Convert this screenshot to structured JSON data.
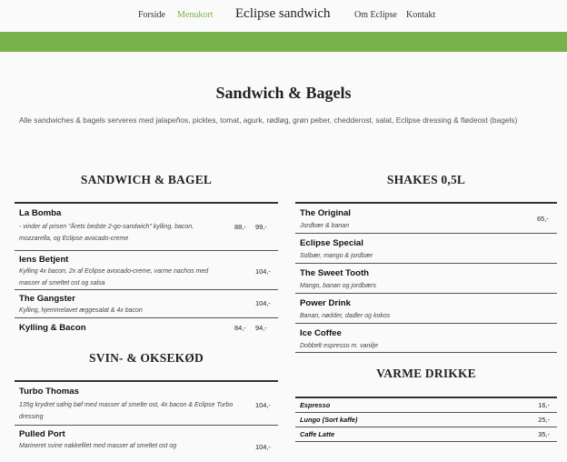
{
  "nav": {
    "items": [
      "Forside",
      "Menukort",
      "Om Eclipse",
      "Kontakt"
    ],
    "brand": "Eclipse sandwich"
  },
  "colors": {
    "accent": "#77b24a",
    "active_nav": "#7cb342"
  },
  "page_title": "Sandwich & Bagels",
  "intro": "Alle sandwiches & bagels serveres med jalapeños, pickles, tomat, agurk, rødløg, grøn peber, chedderost, salat, Eclipse dressing & flødeost (bagels)",
  "sandwich": {
    "title": "SANDWICH & BAGEL",
    "items": [
      {
        "name": "La Bomba",
        "desc": "- vinder af prisen \"Årets bedste 2-go-sandwich\" kylling, bacon, mozzarella, og Eclipse avocado-creme",
        "price1": "88,-",
        "price2": "99,-"
      },
      {
        "name": "Iens Betjent",
        "desc": "Kylling 4x bacon, 2x af Eclipse avocado-creme, varme nachos med masser af smeltet ost og salsa",
        "price1": "104,-",
        "price2": ""
      },
      {
        "name": "The Gangster",
        "desc": "Kylling, hjemmelavet æggesalat & 4x bacon",
        "price1": "104,-",
        "price2": ""
      },
      {
        "name": "Kylling & Bacon",
        "desc": "",
        "price1": "84,-",
        "price2": "94,-"
      }
    ]
  },
  "svin": {
    "title": "SVIN- & OKSEKØD",
    "items": [
      {
        "name": "Turbo Thomas",
        "desc": "135g krydret safrig bøf med masser af smelte ost, 4x bacon & Eclipse Turbo dressing",
        "price1": "104,-"
      },
      {
        "name": "Pulled Port",
        "desc": "Marineret svine nakkefilet med masser af smeltet ost og",
        "price1": "104,-"
      }
    ]
  },
  "shakes": {
    "title": "SHAKES 0,5L",
    "price": "65,-",
    "items": [
      {
        "name": "The Original",
        "desc": "Jordbær & banan"
      },
      {
        "name": "Eclipse Special",
        "desc": "Solbær, mango & jordbær"
      },
      {
        "name": "The Sweet Tooth",
        "desc": "Mango, banan og jordbærs"
      },
      {
        "name": "Power Drink",
        "desc": "Banan, nødder, dadler og kokos"
      },
      {
        "name": "Ice Coffee",
        "desc": "Dobbelt espresso m. vanilje"
      }
    ]
  },
  "varme": {
    "title": "VARME DRIKKE",
    "items": [
      {
        "name": "Espresso",
        "price": "16,-"
      },
      {
        "name": "Lungo (Sort kaffe)",
        "price": "25,-"
      },
      {
        "name": "Caffe Latte",
        "price": "35,-"
      }
    ]
  }
}
